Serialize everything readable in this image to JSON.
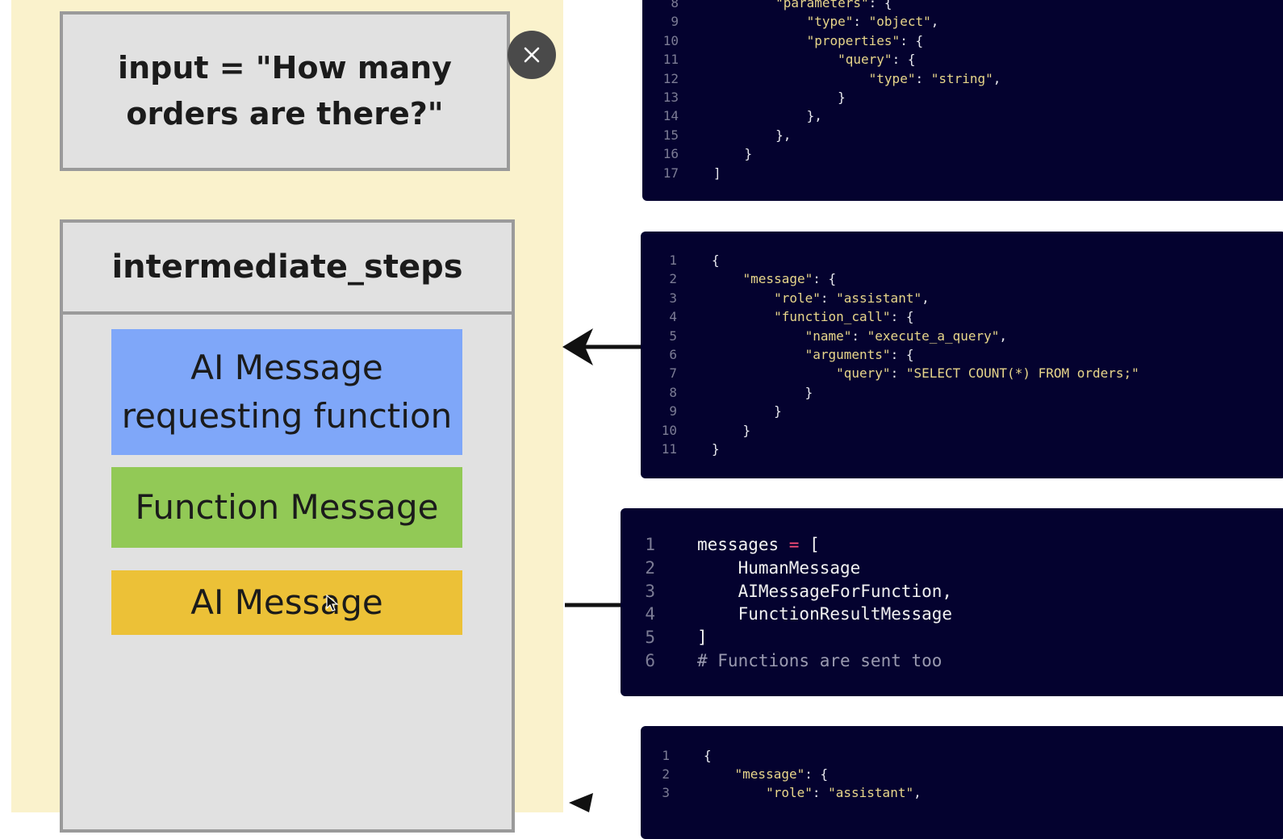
{
  "diagram": {
    "input_text": "input = \"How many orders are there?\"",
    "steps_title": "intermediate_steps",
    "messages": [
      {
        "label": "AI Message requesting function",
        "color": "#7fa7f9"
      },
      {
        "label": "Function Message",
        "color": "#92c956"
      },
      {
        "label": "AI Message",
        "color": "#ecc137"
      }
    ],
    "panel_color": "#faf2cc"
  },
  "code_top": {
    "lines": [
      {
        "n": "8",
        "t": "        \"parameters\": {"
      },
      {
        "n": "9",
        "t": "            \"type\": \"object\","
      },
      {
        "n": "10",
        "t": "            \"properties\": {"
      },
      {
        "n": "11",
        "t": "                \"query\": {"
      },
      {
        "n": "12",
        "t": "                    \"type\": \"string\","
      },
      {
        "n": "13",
        "t": "                }"
      },
      {
        "n": "14",
        "t": "            },"
      },
      {
        "n": "15",
        "t": "        },"
      },
      {
        "n": "16",
        "t": "    }"
      },
      {
        "n": "17",
        "t": "]"
      }
    ]
  },
  "code_function_call": {
    "lines": [
      {
        "n": "1",
        "t": "{"
      },
      {
        "n": "2",
        "t": "    \"message\": {"
      },
      {
        "n": "3",
        "t": "        \"role\": \"assistant\","
      },
      {
        "n": "4",
        "t": "        \"function_call\": {"
      },
      {
        "n": "5",
        "t": "            \"name\": \"execute_a_query\","
      },
      {
        "n": "6",
        "t": "            \"arguments\": {"
      },
      {
        "n": "7",
        "t": "                \"query\": \"SELECT COUNT(*) FROM orders;\""
      },
      {
        "n": "8",
        "t": "            }"
      },
      {
        "n": "9",
        "t": "        }"
      },
      {
        "n": "10",
        "t": "    }"
      },
      {
        "n": "11",
        "t": "}"
      }
    ]
  },
  "code_messages": {
    "lines": [
      {
        "n": "1",
        "t": "messages = ["
      },
      {
        "n": "2",
        "t": "    HumanMessage"
      },
      {
        "n": "3",
        "t": "    AIMessageForFunction,"
      },
      {
        "n": "4",
        "t": "    FunctionResultMessage"
      },
      {
        "n": "5",
        "t": "]"
      },
      {
        "n": "6",
        "t": "# Functions are sent too"
      }
    ]
  },
  "code_bottom": {
    "lines": [
      {
        "n": "1",
        "t": "{"
      },
      {
        "n": "2",
        "t": "    \"message\": {"
      },
      {
        "n": "3",
        "t": "        \"role\": \"assistant\","
      }
    ]
  }
}
